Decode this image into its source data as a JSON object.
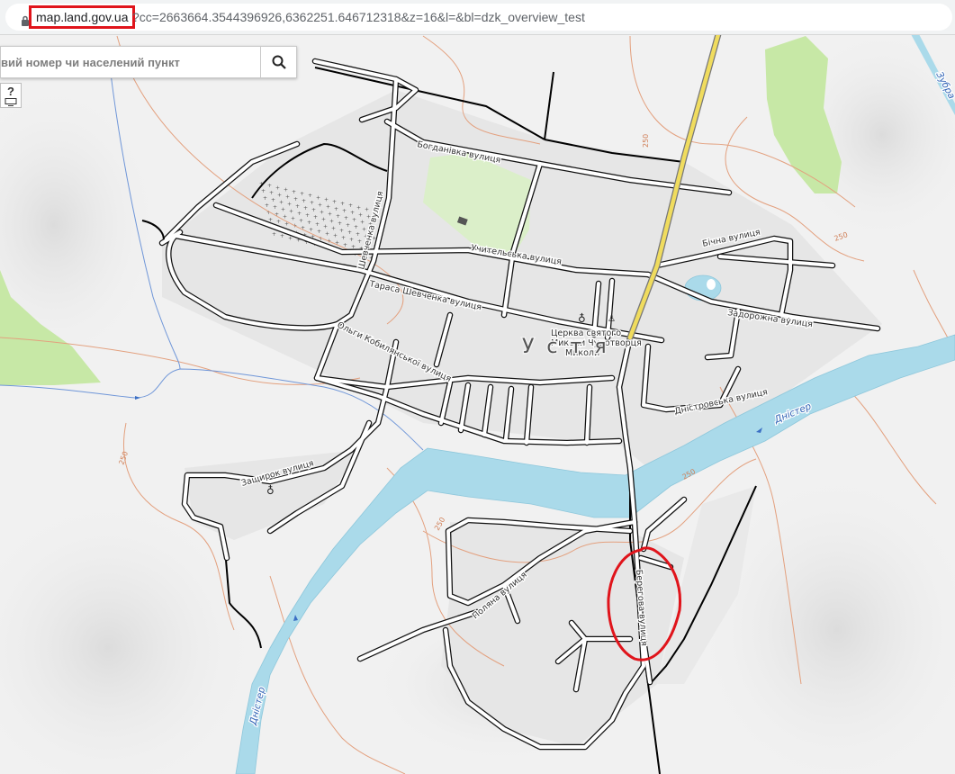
{
  "browser": {
    "domain": "map.land.gov.ua",
    "url_rest": "?cc=2663664.3544396926,6362251.646712318&z=16&l=&bl=dzk_overview_test"
  },
  "search": {
    "placeholder": "вий номер чи населений пункт"
  },
  "help_label": "?",
  "map": {
    "settlement": "Устя",
    "streets": {
      "bohdanivka": "Богданівка вулиця",
      "uchytelska": "Учительська вулиця",
      "shevchenka1": "Шевченка вулиця",
      "tarasa_shevchenka": "Тараса Шевченка вулиця",
      "kobylianskoi": "Ольги Кобилянської вулиця",
      "bichna": "Бічна вулиця",
      "zadorozhna": "Задорожна вулиця",
      "dnistrovska": "Дністровська вулиця",
      "zashchyrok": "Защирок вулиця",
      "poliana": "Поляна вулиця",
      "berehova": "Берегова вулиця"
    },
    "church": [
      "Церква святого",
      "Миколи Чудотворця",
      "Миколи"
    ],
    "rivers": {
      "dnister": "Дністер",
      "dnister2": "Дністер",
      "zubra": "Зубра"
    },
    "contours": [
      "250",
      "250",
      "250",
      "250",
      "250"
    ],
    "colors": {
      "river": "#aadaea",
      "road_major": "#f0dc5e",
      "forest": "#c7e8a6",
      "highlight": "#e0141b"
    }
  }
}
